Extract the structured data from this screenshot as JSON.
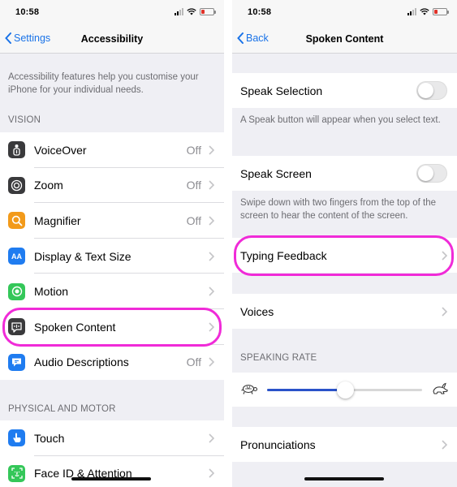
{
  "left": {
    "status": {
      "time": "10:58"
    },
    "nav": {
      "back": "Settings",
      "title": "Accessibility"
    },
    "intro": "Accessibility features help you customise your iPhone for your individual needs.",
    "vision_header": "VISION",
    "vision_items": [
      {
        "label": "VoiceOver",
        "value": "Off",
        "icon": "voiceover-icon",
        "color": "#3a3a3c"
      },
      {
        "label": "Zoom",
        "value": "Off",
        "icon": "zoom-icon",
        "color": "#3a3a3c"
      },
      {
        "label": "Magnifier",
        "value": "Off",
        "icon": "magnifier-icon",
        "color": "#f29a1a"
      },
      {
        "label": "Display & Text Size",
        "value": "",
        "icon_text": "AA",
        "icon": "display-text-size-icon",
        "color": "#1f7cf0"
      },
      {
        "label": "Motion",
        "value": "",
        "icon": "motion-icon",
        "color": "#34c759"
      },
      {
        "label": "Spoken Content",
        "value": "",
        "icon": "spoken-content-icon",
        "color": "#3a3a3c"
      },
      {
        "label": "Audio Descriptions",
        "value": "Off",
        "icon": "audio-descriptions-icon",
        "color": "#1f7cf0"
      }
    ],
    "motor_header": "PHYSICAL AND MOTOR",
    "motor_items": [
      {
        "label": "Touch",
        "value": "",
        "icon": "touch-icon",
        "color": "#1f7cf0"
      },
      {
        "label": "Face ID & Attention",
        "value": "",
        "icon": "face-id-icon",
        "color": "#34c759"
      }
    ]
  },
  "right": {
    "status": {
      "time": "10:58"
    },
    "nav": {
      "back": "Back",
      "title": "Spoken Content"
    },
    "speak_selection": {
      "label": "Speak Selection",
      "on": false,
      "note": "A Speak button will appear when you select text."
    },
    "speak_screen": {
      "label": "Speak Screen",
      "on": false,
      "note": "Swipe down with two fingers from the top of the screen to hear the content of the screen."
    },
    "typing_feedback": "Typing Feedback",
    "voices": "Voices",
    "speaking_rate_header": "SPEAKING RATE",
    "speaking_rate": 0.5,
    "pronunciations": "Pronunciations"
  },
  "colors": {
    "highlight": "#f02bd8",
    "tint": "#1a73e8",
    "slider_fill": "#2a53c9"
  }
}
